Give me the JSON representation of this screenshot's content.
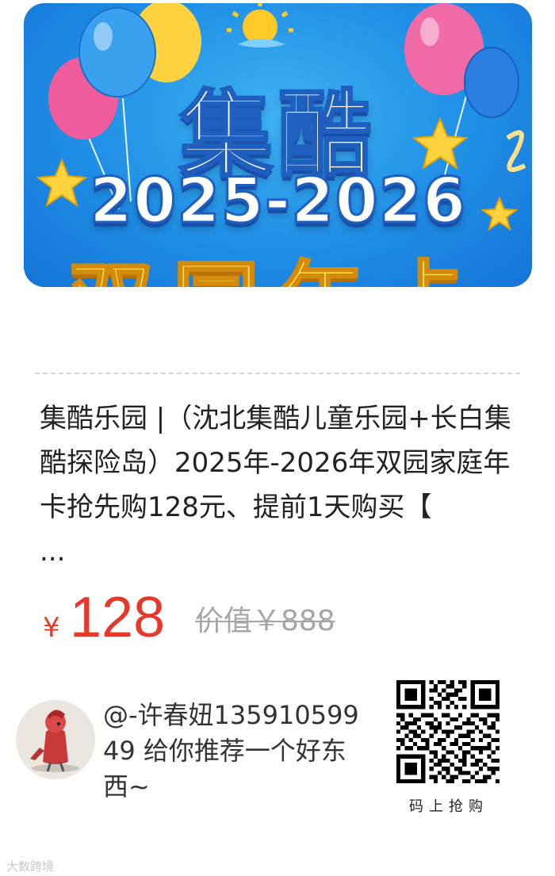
{
  "banner": {
    "title": "集酷",
    "years": "2025-2026",
    "subtitle": "双园年卡"
  },
  "product": {
    "title": "集酷乐园 |（沈北集酷儿童乐园+长白集酷探险岛）2025年-2026年双园家庭年卡抢先购128元、提前1天购买【",
    "ellipsis": "..."
  },
  "price": {
    "currency": "¥",
    "value": "128",
    "original": "价值￥888"
  },
  "recommend": {
    "text": "@-许春妞13591059949 给你推荐一个好东西~"
  },
  "qr": {
    "caption": "码上抢购"
  },
  "watermark": {
    "text": "大数跨境"
  },
  "colors": {
    "price": "#e53a2b",
    "banner_blue": "#1f8ee6",
    "title_text": "#222222"
  }
}
